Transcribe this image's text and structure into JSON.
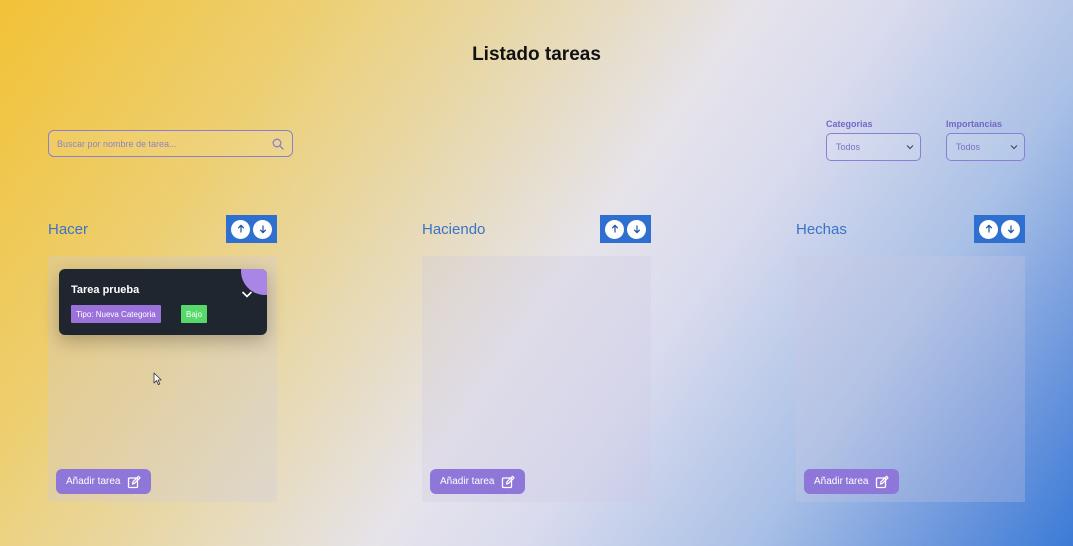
{
  "page": {
    "title": "Listado tareas"
  },
  "search": {
    "placeholder": "Buscar por nombre de tarea...",
    "icon": "search-icon"
  },
  "filters": {
    "categorias": {
      "label": "Categorias",
      "selected": "Todos"
    },
    "importancias": {
      "label": "Importancias",
      "selected": "Todos"
    }
  },
  "columns": [
    {
      "title": "Hacer",
      "add_label": "Añadir tarea",
      "cards": [
        {
          "title": "Tarea prueba",
          "tipo": "Tipo: Nueva Categoria",
          "importancia": "Bajo"
        }
      ]
    },
    {
      "title": "Haciendo",
      "add_label": "Añadir tarea",
      "cards": []
    },
    {
      "title": "Hechas",
      "add_label": "Añadir tarea",
      "cards": []
    }
  ],
  "colors": {
    "accent": "#2f6fd0",
    "column_title": "#3a73c8",
    "add_button": "#8f76d9",
    "card_bg": "#1f2630",
    "badge_tipo": "#9b71da",
    "badge_bajo": "#56d86a"
  }
}
